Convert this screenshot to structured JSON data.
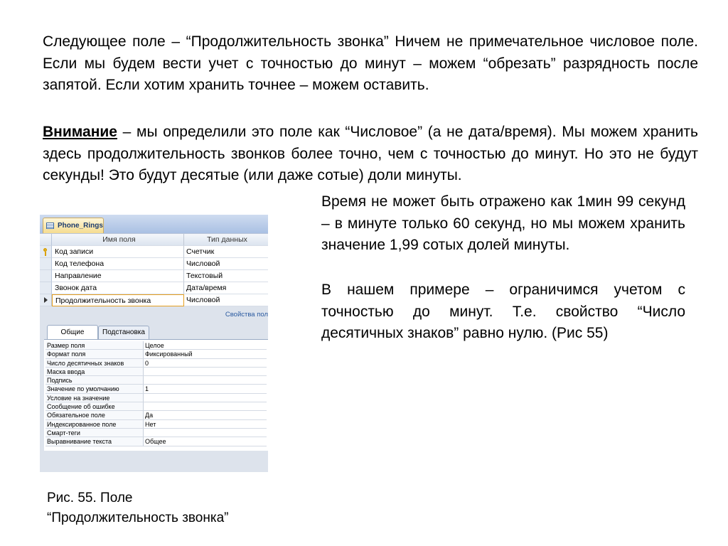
{
  "text": {
    "p1": "Следующее поле – “Продолжительность звонка” Ничем не примечательное числовое поле. Если мы будем вести учет с точностью до минут – можем “обрезать” разрядность после запятой. Если хотим хранить точнее – можем оставить.",
    "p2_bold": "Внимание",
    "p2_rest": " – мы определили это поле как “Числовое” (а не дата/время).  Мы можем хранить здесь продолжительность звонков более точно, чем с точностью до минут. Но это не будут секунды! Это будут десятые (или даже сотые) доли минуты.",
    "p3": "Время не может быть отражено как 1мин 99 секунд – в минуте только 60 секунд, но мы можем хранить значение 1,99 сотых долей минуты.",
    "p4": "В нашем примере – ограничимся учетом с точностью до минут. Т.е. свойство “Число десятичных знаков” равно нулю. (Рис 55)",
    "caption_line1": "Рис. 55. Поле",
    "caption_line2": "“Продолжительность звонка”"
  },
  "access": {
    "table_tab": "Phone_Rings",
    "header": {
      "name": "Имя поля",
      "type": "Тип данных"
    },
    "fields": [
      {
        "name": "Код записи",
        "type": "Счетчик"
      },
      {
        "name": "Код телефона",
        "type": "Числовой"
      },
      {
        "name": "Направление",
        "type": "Текстовый"
      },
      {
        "name": "Звонок дата",
        "type": "Дата/время"
      },
      {
        "name": "Продолжительность звонка",
        "type": "Числовой"
      }
    ],
    "props_link": "Свойства пол",
    "tabs": {
      "general": "Общие",
      "lookup": "Подстановка"
    },
    "properties": [
      {
        "name": "Размер поля",
        "value": "Целое"
      },
      {
        "name": "Формат поля",
        "value": "Фиксированный"
      },
      {
        "name": "Число десятичных знаков",
        "value": "0"
      },
      {
        "name": "Маска ввода",
        "value": ""
      },
      {
        "name": "Подпись",
        "value": ""
      },
      {
        "name": "Значение по умолчанию",
        "value": "1"
      },
      {
        "name": "Условие на значение",
        "value": ""
      },
      {
        "name": "Сообщение об ошибке",
        "value": ""
      },
      {
        "name": "Обязательное поле",
        "value": "Да"
      },
      {
        "name": "Индексированное поле",
        "value": "Нет"
      },
      {
        "name": "Смарт-теги",
        "value": ""
      },
      {
        "name": "Выравнивание текста",
        "value": "Общее"
      }
    ]
  }
}
